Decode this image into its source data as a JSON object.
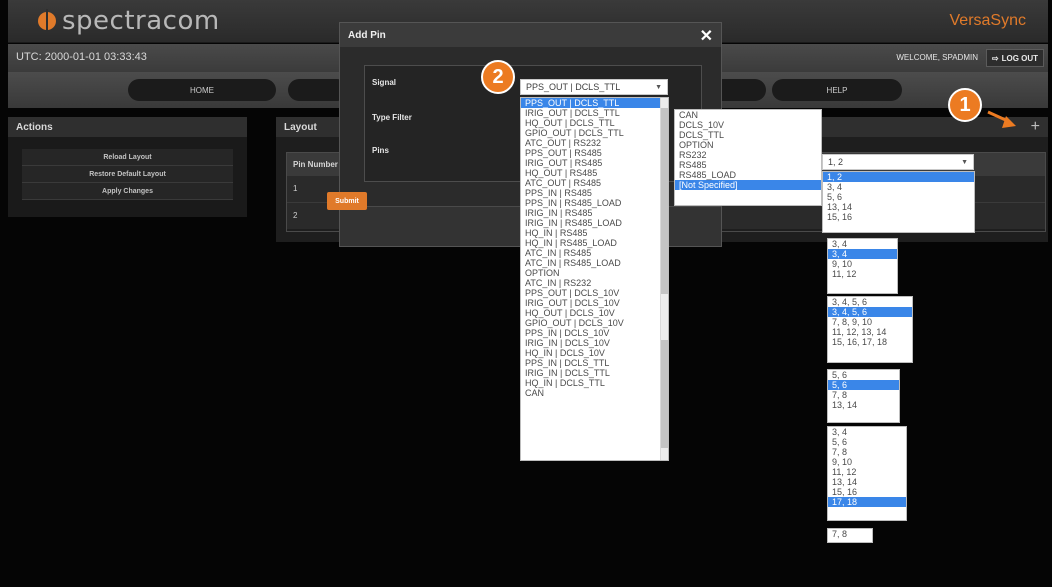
{
  "app": {
    "logo_text": "spectracom",
    "product_name": "VersaSync",
    "utc_text": "UTC: 2000-01-01 03:33:43",
    "welcome_text": "WELCOME, SPADMIN",
    "logout_label": "LOG OUT"
  },
  "nav": {
    "home": "HOME",
    "help": "HELP"
  },
  "actions": {
    "title": "Actions",
    "reload": "Reload Layout",
    "restore": "Restore Default Layout",
    "apply": "Apply Changes"
  },
  "layout": {
    "title": "Layout",
    "add_icon": "+",
    "pin_header": "Pin Number",
    "rows": [
      "1",
      "2"
    ]
  },
  "modal": {
    "title": "Add Pin",
    "close": "✕",
    "signal_label": "Signal",
    "type_filter_label": "Type Filter",
    "pins_label": "Pins",
    "signal_value": "PPS_OUT | DCLS_TTL",
    "submit": "Submit"
  },
  "signal_options": [
    "PPS_OUT | DCLS_TTL",
    "IRIG_OUT | DCLS_TTL",
    "HQ_OUT | DCLS_TTL",
    "GPIO_OUT | DCLS_TTL",
    "ATC_OUT | RS232",
    "PPS_OUT | RS485",
    "IRIG_OUT | RS485",
    "HQ_OUT | RS485",
    "ATC_OUT | RS485",
    "PPS_IN | RS485",
    "PPS_IN | RS485_LOAD",
    "IRIG_IN | RS485",
    "IRIG_IN | RS485_LOAD",
    "HQ_IN | RS485",
    "HQ_IN | RS485_LOAD",
    "ATC_IN | RS485",
    "ATC_IN | RS485_LOAD",
    "OPTION",
    "ATC_IN | RS232",
    "PPS_OUT | DCLS_10V",
    "IRIG_OUT | DCLS_10V",
    "HQ_OUT | DCLS_10V",
    "GPIO_OUT | DCLS_10V",
    "PPS_IN | DCLS_10V",
    "IRIG_IN | DCLS_10V",
    "HQ_IN | DCLS_10V",
    "PPS_IN | DCLS_TTL",
    "IRIG_IN | DCLS_TTL",
    "HQ_IN | DCLS_TTL",
    "CAN"
  ],
  "type_filter_options": [
    "CAN",
    "DCLS_10V",
    "DCLS_TTL",
    "OPTION",
    "RS232",
    "RS485",
    "RS485_LOAD",
    "[Not Specified]"
  ],
  "pins_select": {
    "value": "1, 2",
    "options": [
      "1, 2",
      "3, 4",
      "5, 6",
      "13, 14",
      "15, 16"
    ]
  },
  "pin_lists": [
    [
      "3, 4",
      "3, 4",
      "9, 10",
      "11, 12"
    ],
    [
      "3, 4, 5, 6",
      "3, 4, 5, 6",
      "7, 8, 9, 10",
      "11, 12, 13, 14",
      "15, 16, 17, 18"
    ],
    [
      "5, 6",
      "5, 6",
      "7, 8",
      "13, 14"
    ],
    [
      "3, 4",
      "5, 6",
      "7, 8",
      "9, 10",
      "11, 12",
      "13, 14",
      "15, 16",
      "17, 18"
    ],
    [
      "7, 8"
    ]
  ],
  "callouts": [
    "1",
    "2"
  ],
  "colors": {
    "accent_orange": "#e07a2a",
    "selection_blue": "#3a86e8",
    "background": "#050505"
  }
}
